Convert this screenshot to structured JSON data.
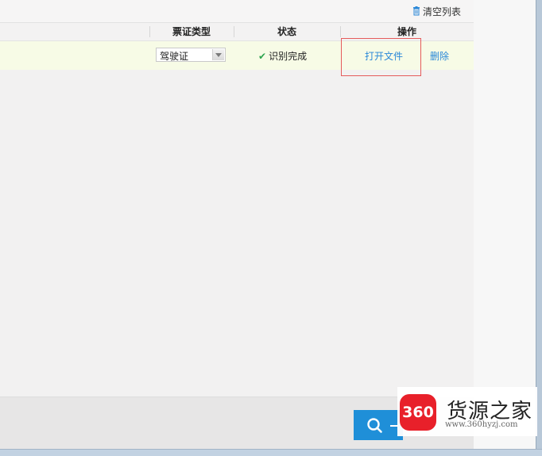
{
  "toolbar": {
    "clear_list_label": "清空列表"
  },
  "table": {
    "columns": [
      "票证类型",
      "状态",
      "操作"
    ],
    "rows": [
      {
        "ticket_type": "驾驶证",
        "status": "识别完成",
        "actions": {
          "open_label": "打开文件",
          "delete_label": "删除"
        }
      }
    ]
  },
  "icons": {
    "clear": "trash-icon",
    "status": "check-icon",
    "search": "search-icon"
  },
  "colors": {
    "link": "#2a88d8",
    "highlight_border": "#e55b5b",
    "row_background": "#f7fbe6",
    "primary_button": "#1f8fd8",
    "success": "#2ea44f"
  },
  "watermark": {
    "badge_text": "360",
    "title": "货源之家",
    "url": "www.360hyzj.com"
  }
}
